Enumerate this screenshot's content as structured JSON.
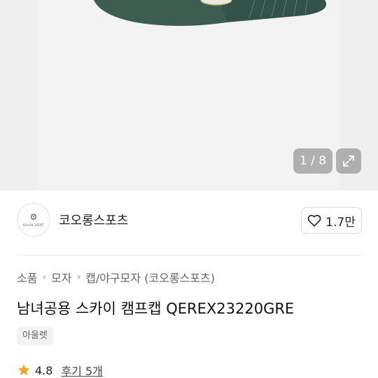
{
  "gallery": {
    "current_index": "1",
    "separator": "/",
    "total": "8",
    "counter_text": "1 / 8"
  },
  "brand": {
    "logo_text": "KOLON SPORT",
    "name": "코오롱스포츠"
  },
  "like": {
    "count": "1.7만"
  },
  "breadcrumb": [
    {
      "label": "소품"
    },
    {
      "label": "모자"
    },
    {
      "label": "캡/야구모자 (코오롱스포츠)"
    }
  ],
  "product": {
    "title": "남녀공용 스카이 캠프캡 QEREX23220GRE",
    "badge": "아울렛",
    "rating": "4.8",
    "review_link": "후기 5개"
  },
  "colors": {
    "star": "#f5a623",
    "cap": "#3b5b4f"
  }
}
